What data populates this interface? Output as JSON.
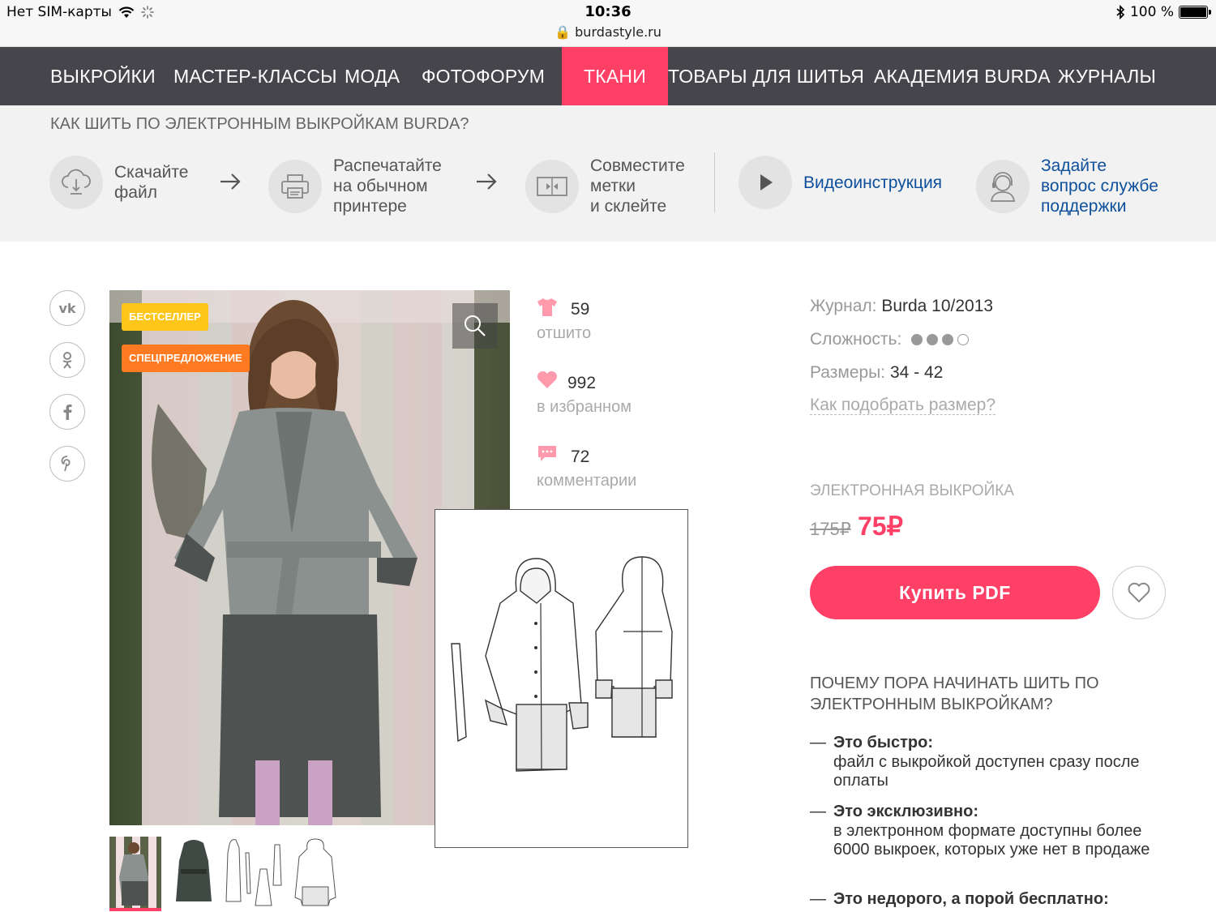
{
  "status_bar": {
    "carrier": "Нет SIM-карты",
    "time": "10:36",
    "url": "burdastyle.ru",
    "battery": "100 %"
  },
  "nav": {
    "items": [
      "ВЫКРОЙКИ",
      "МАСТЕР-КЛАССЫ",
      "МОДА",
      "ФОТОФОРУМ",
      "ТКАНИ",
      "ТОВАРЫ ДЛЯ ШИТЬЯ",
      "АКАДЕМИЯ BURDA",
      "ЖУРНАЛЫ"
    ],
    "active": "ТКАНИ",
    "active_color": "#ff4066",
    "bg_color": "#45454b"
  },
  "howto": {
    "title": "КАК ШИТЬ ПО ЭЛЕКТРОННЫМ ВЫКРОЙКАМ BURDA?",
    "steps": [
      {
        "icon": "cloud-download-icon",
        "lines": [
          "Скачайте",
          "файл"
        ]
      },
      {
        "icon": "printer-icon",
        "lines": [
          "Распечатайте",
          "на обычном",
          "принтере"
        ]
      },
      {
        "icon": "align-marks-icon",
        "lines": [
          "Совместите",
          "метки",
          "и склейте"
        ]
      }
    ],
    "video": {
      "icon": "play-icon",
      "label": "Видеоинструкция"
    },
    "support": {
      "icon": "support-agent-icon",
      "lines": [
        "Задайте",
        "вопрос службе",
        "поддержки"
      ]
    }
  },
  "social": [
    "vk-icon",
    "odnoklassniki-icon",
    "facebook-icon",
    "pinterest-icon"
  ],
  "product": {
    "badges": [
      "БЕСТСЕЛЛЕР",
      "СПЕЦПРЕДЛОЖЕНИЕ"
    ],
    "badge_colors": [
      "#ffc61a",
      "#ff7a21"
    ],
    "stats": [
      {
        "icon": "tshirt-icon",
        "value": "59",
        "label": "отшито"
      },
      {
        "icon": "heart-icon",
        "value": "992",
        "label": "в избранном"
      },
      {
        "icon": "comment-icon",
        "value": "72",
        "label": "комментарии"
      }
    ],
    "magazine_label": "Журнал:",
    "magazine_value": "Burda 10/2013",
    "difficulty_label": "Сложность:",
    "difficulty_level": 3,
    "difficulty_max": 4,
    "sizes_label": "Размеры:",
    "sizes_value": "34 - 42",
    "size_help": "Как подобрать размер?",
    "pattern_type": "ЭЛЕКТРОННАЯ ВЫКРОЙКА",
    "old_price": "175₽",
    "new_price": "75₽",
    "buy_label": "Купить PDF",
    "thumbnails": 4,
    "selected_thumbnail": 1
  },
  "why": {
    "title": "ПОЧЕМУ ПОРА НАЧИНАТЬ ШИТЬ ПО ЭЛЕКТРОННЫМ ВЫКРОЙКАМ?",
    "reasons": [
      {
        "title": "Это быстро:",
        "text": "файл с выкройкой доступен сразу после оплаты"
      },
      {
        "title": "Это эксклюзивно:",
        "text": "в электронном формате доступны более 6000 выкроек, которых уже нет в продаже"
      },
      {
        "title": "Это недорого, а порой бесплатно:",
        "text": ""
      }
    ]
  }
}
